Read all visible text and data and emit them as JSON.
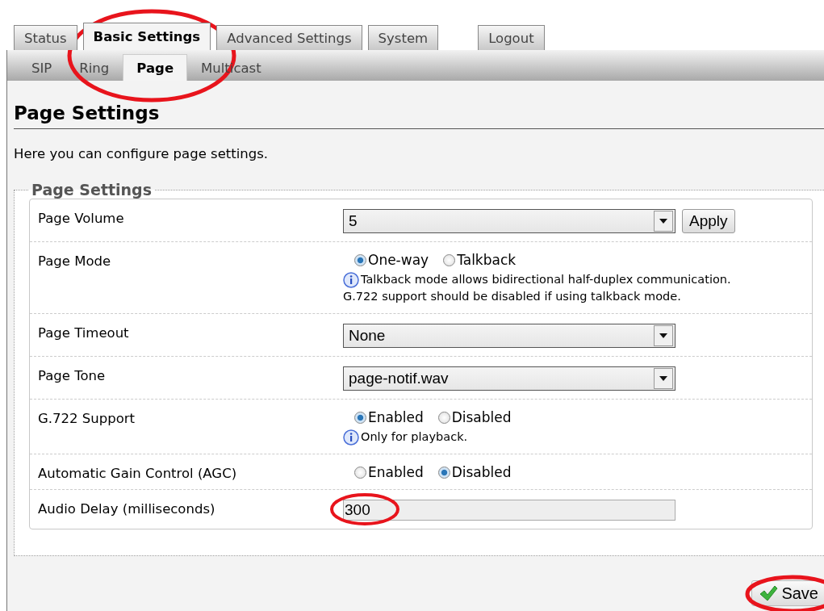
{
  "main_tabs": [
    {
      "label": "Status",
      "selected": false
    },
    {
      "label": "Basic Settings",
      "selected": true
    },
    {
      "label": "Advanced Settings",
      "selected": false
    },
    {
      "label": "System",
      "selected": false
    }
  ],
  "logout_tab": {
    "label": "Logout"
  },
  "sub_tabs": [
    {
      "label": "SIP",
      "selected": false
    },
    {
      "label": "Ring",
      "selected": false
    },
    {
      "label": "Page",
      "selected": true
    },
    {
      "label": "Multicast",
      "selected": false
    }
  ],
  "heading": "Page Settings",
  "description": "Here you can configure page settings.",
  "section": {
    "legend": "Page Settings",
    "rows": [
      {
        "kind": "select",
        "label": "Page Volume",
        "value": "5",
        "button": "Apply"
      },
      {
        "kind": "radio",
        "label": "Page Mode",
        "options": [
          {
            "label": "One-way",
            "selected": true
          },
          {
            "label": "Talkback",
            "selected": false
          }
        ],
        "note": [
          "Talkback mode allows bidirectional half-duplex communication.",
          "G.722 support should be disabled if using talkback mode."
        ]
      },
      {
        "kind": "select",
        "label": "Page Timeout",
        "value": "None"
      },
      {
        "kind": "select",
        "label": "Page Tone",
        "value": "page-notif.wav"
      },
      {
        "kind": "radio",
        "label": "G.722 Support",
        "options": [
          {
            "label": "Enabled",
            "selected": true
          },
          {
            "label": "Disabled",
            "selected": false
          }
        ],
        "note": [
          "Only for playback."
        ]
      },
      {
        "kind": "radio",
        "label": "Automatic Gain Control (AGC)",
        "options": [
          {
            "label": "Enabled",
            "selected": false
          },
          {
            "label": "Disabled",
            "selected": true
          }
        ]
      },
      {
        "kind": "text",
        "label": "Audio Delay (milliseconds)",
        "value": "300"
      }
    ]
  },
  "save_button": "Save"
}
